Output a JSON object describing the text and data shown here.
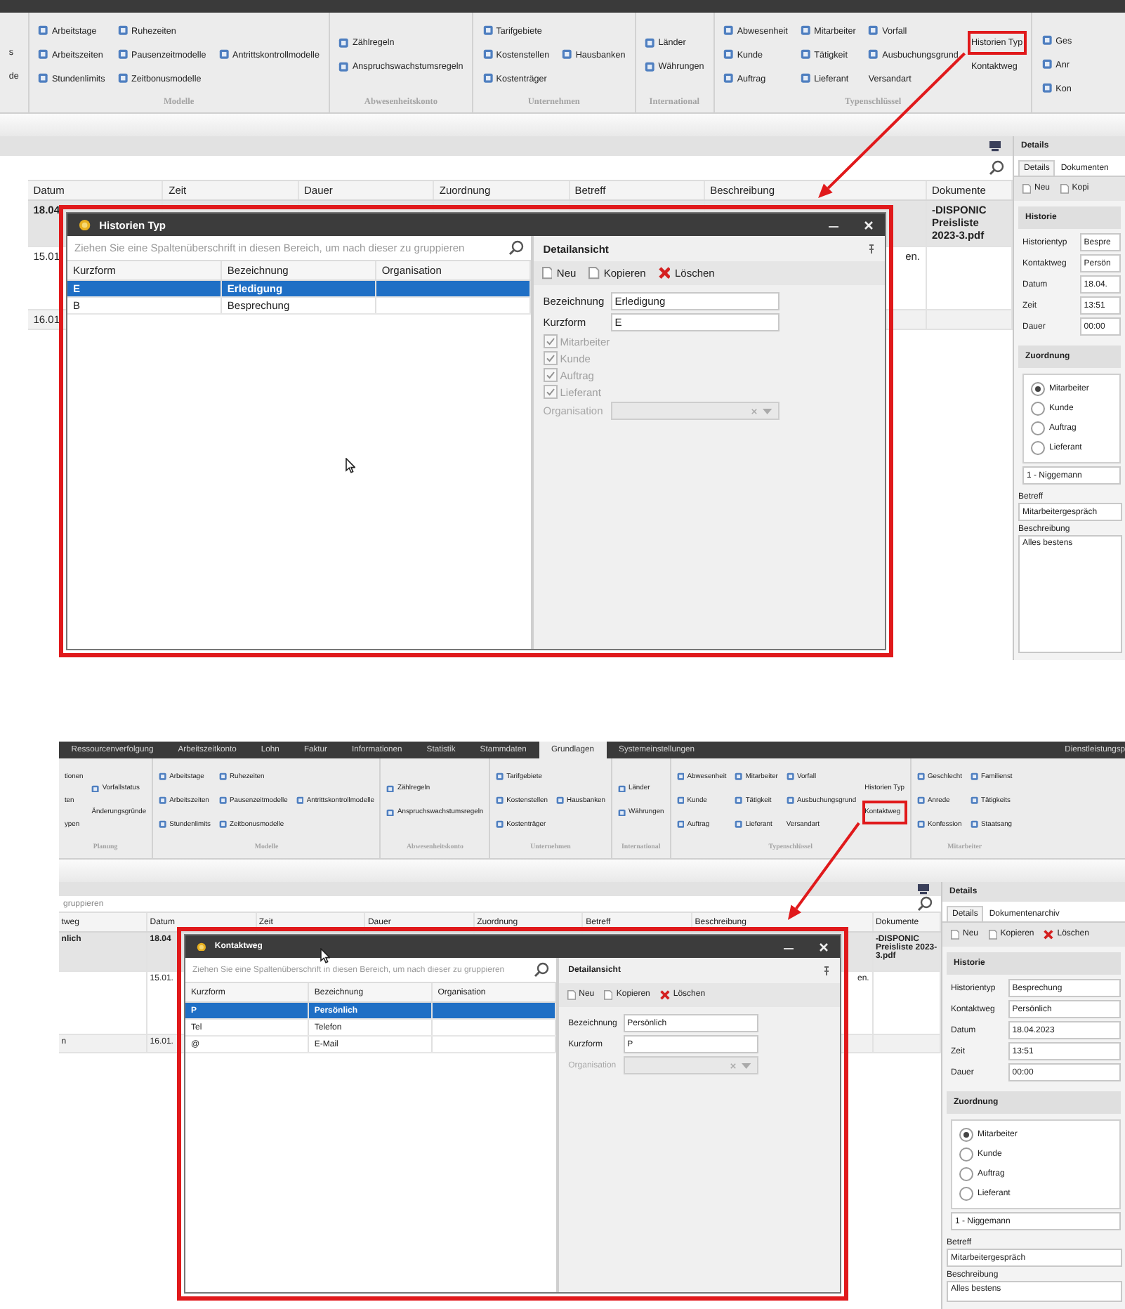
{
  "screenshots": [
    {
      "ribbon": [
        {
          "columns": [
            [
              {
                "label": "s",
                "icon": false,
                "marked": false
              },
              {
                "label": "de",
                "icon": false,
                "marked": false
              }
            ]
          ]
        },
        {
          "label": "Modelle",
          "columns": [
            [
              {
                "label": "Arbeitstage",
                "icon": true,
                "marked": false
              },
              {
                "label": "Arbeitszeiten",
                "icon": true,
                "marked": false
              },
              {
                "label": "Stundenlimits",
                "icon": true,
                "marked": false
              }
            ],
            [
              {
                "label": "Ruhezeiten",
                "icon": true,
                "marked": false
              },
              {
                "label": "Pausenzeitmodelle",
                "icon": true,
                "marked": false
              },
              {
                "label": "Zeitbonusmodelle",
                "icon": true,
                "marked": false
              }
            ],
            [
              {
                "label": "Antrittskontrollmodelle",
                "icon": true,
                "marked": false
              }
            ]
          ]
        },
        {
          "label": "Abwesenheitskonto",
          "columns": [
            [
              {
                "label": "Zählregeln",
                "icon": true,
                "marked": false
              },
              {
                "label": "Anspruchswachstumsregeln",
                "icon": true,
                "marked": false
              }
            ]
          ]
        },
        {
          "label": "Unternehmen",
          "columns": [
            [
              {
                "label": "Tarifgebiete",
                "icon": true,
                "marked": false
              },
              {
                "label": "Kostenstellen",
                "icon": true,
                "marked": false
              },
              {
                "label": "Kostenträger",
                "icon": true,
                "marked": false
              }
            ],
            [
              {
                "label": "Hausbanken",
                "icon": true,
                "marked": false
              }
            ]
          ]
        },
        {
          "label": "International",
          "columns": [
            [
              {
                "label": "Länder",
                "icon": true,
                "marked": false
              },
              {
                "label": "Währungen",
                "icon": true,
                "marked": false
              }
            ]
          ]
        },
        {
          "label": "Typenschlüssel",
          "columns": [
            [
              {
                "label": "Abwesenheit",
                "icon": true,
                "marked": false
              },
              {
                "label": "Kunde",
                "icon": true,
                "marked": false
              },
              {
                "label": "Auftrag",
                "icon": true,
                "marked": false
              }
            ],
            [
              {
                "label": "Mitarbeiter",
                "icon": true,
                "marked": false
              },
              {
                "label": "Tätigkeit",
                "icon": true,
                "marked": false
              },
              {
                "label": "Lieferant",
                "icon": true,
                "marked": false
              }
            ],
            [
              {
                "label": "Vorfall",
                "icon": true,
                "marked": false
              },
              {
                "label": "Ausbuchungsgrund",
                "icon": true,
                "marked": false
              },
              {
                "label": "Versandart",
                "icon": false,
                "marked": false
              }
            ],
            [
              {
                "label": "Historien Typ",
                "icon": false,
                "marked": true
              },
              {
                "label": "Kontaktweg",
                "icon": false,
                "marked": false
              }
            ]
          ]
        },
        {
          "columns": [
            [
              {
                "label": "Ges",
                "icon": true,
                "marked": false
              },
              {
                "label": "Anr",
                "icon": true,
                "marked": false
              },
              {
                "label": "Kon",
                "icon": true,
                "marked": false
              }
            ]
          ]
        }
      ],
      "grid": {
        "columns": [
          "Datum",
          "Zeit",
          "Dauer",
          "Zuordnung",
          "Betreff",
          "Beschreibung",
          "Dokumente"
        ],
        "rows": [
          {
            "selected": true,
            "cells": [
              "18.04",
              null,
              null,
              null,
              null,
              null,
              "-DISPONIC Preisliste 2023-3.pdf"
            ]
          },
          {
            "selected": false,
            "cells": [
              "15.01",
              null,
              null,
              null,
              null,
              "en.",
              null
            ]
          },
          {
            "selected": false,
            "cells": [
              "16.01",
              null,
              null,
              null,
              null,
              null,
              null
            ]
          }
        ]
      },
      "details": {
        "title": "Details",
        "tabs": [
          {
            "label": "Details",
            "selected": true
          },
          {
            "label": "Dokumenten",
            "selected": false
          }
        ],
        "actions": [
          {
            "label": "Neu",
            "kind": "new"
          },
          {
            "label": "Kopi",
            "kind": "copy"
          }
        ],
        "history": {
          "title": "Historie",
          "fields": [
            {
              "label": "Historientyp",
              "value": "Bespre"
            },
            {
              "label": "Kontaktweg",
              "value": "Persön"
            },
            {
              "label": "Datum",
              "value": "18.04."
            },
            {
              "label": "Zeit",
              "value": "13:51"
            },
            {
              "label": "Dauer",
              "value": "00:00"
            }
          ]
        },
        "assignment": {
          "title": "Zuordnung",
          "options": [
            {
              "label": "Mitarbeiter",
              "selected": true
            },
            {
              "label": "Kunde",
              "selected": false
            },
            {
              "label": "Auftrag",
              "selected": false
            },
            {
              "label": "Lieferant",
              "selected": false
            }
          ],
          "dropdown": "1 - Niggemann"
        },
        "subject": {
          "label": "Betreff",
          "value": "Mitarbeitergespräch"
        },
        "description": {
          "label": "Beschreibung",
          "value": "Alles bestens"
        }
      },
      "dialog": {
        "title": "Historien Typ",
        "marked": true,
        "search_placeholder": "Ziehen Sie eine Spaltenüberschrift in diesen Bereich, um nach dieser zu gruppieren",
        "columns": [
          "Kurzform",
          "Bezeichnung",
          "Organisation"
        ],
        "rows": [
          {
            "selected": true,
            "cells": [
              "E",
              "Erledigung",
              null
            ]
          },
          {
            "selected": false,
            "cells": [
              "B",
              "Besprechung",
              null
            ]
          }
        ],
        "detail": {
          "title": "Detailansicht",
          "actions": [
            {
              "label": "Neu",
              "kind": "new"
            },
            {
              "label": "Kopieren",
              "kind": "copy"
            },
            {
              "label": "Löschen",
              "kind": "delete"
            }
          ],
          "fields": [
            {
              "label": "Bezeichnung",
              "value": "Erledigung"
            },
            {
              "label": "Kurzform",
              "value": "E"
            }
          ],
          "checkboxes": [
            {
              "label": "Mitarbeiter",
              "checked": true,
              "disabled": true
            },
            {
              "label": "Kunde",
              "checked": true,
              "disabled": true
            },
            {
              "label": "Auftrag",
              "checked": true,
              "disabled": true
            },
            {
              "label": "Lieferant",
              "checked": true,
              "disabled": true
            }
          ],
          "dropdown": {
            "label": "Organisation",
            "disabled": true
          }
        }
      }
    },
    {
      "tabs": [
        {
          "label": "Ressourcenverfolgung",
          "selected": false
        },
        {
          "label": "Arbeitszeitkonto",
          "selected": false
        },
        {
          "label": "Lohn",
          "selected": false
        },
        {
          "label": "Faktur",
          "selected": false
        },
        {
          "label": "Informationen",
          "selected": false
        },
        {
          "label": "Statistik",
          "selected": false
        },
        {
          "label": "Stammdaten",
          "selected": false
        },
        {
          "label": "Grundlagen",
          "selected": true
        },
        {
          "label": "Systemeinstellungen",
          "selected": false
        }
      ],
      "side_tab": "Dienstleistungsp",
      "ribbon": [
        {
          "label": "Planung",
          "columns": [
            [
              {
                "label": "tionen",
                "icon": false,
                "marked": false
              },
              {
                "label": "ten",
                "icon": false,
                "marked": false
              },
              {
                "label": "ypen",
                "icon": false,
                "marked": false
              }
            ],
            [
              {
                "label": "Vorfallstatus",
                "icon": true,
                "marked": false
              },
              {
                "label": "Änderungsgründe",
                "icon": false,
                "marked": false
              }
            ]
          ]
        },
        {
          "label": "Modelle",
          "columns": [
            [
              {
                "label": "Arbeitstage",
                "icon": true,
                "marked": false
              },
              {
                "label": "Arbeitszeiten",
                "icon": true,
                "marked": false
              },
              {
                "label": "Stundenlimits",
                "icon": true,
                "marked": false
              }
            ],
            [
              {
                "label": "Ruhezeiten",
                "icon": true,
                "marked": false
              },
              {
                "label": "Pausenzeitmodelle",
                "icon": true,
                "marked": false
              },
              {
                "label": "Zeitbonusmodelle",
                "icon": true,
                "marked": false
              }
            ],
            [
              {
                "label": "Antrittskontrollmodelle",
                "icon": true,
                "marked": false
              }
            ]
          ]
        },
        {
          "label": "Abwesenheitskonto",
          "columns": [
            [
              {
                "label": "Zählregeln",
                "icon": true,
                "marked": false
              },
              {
                "label": "Anspruchswachstumsregeln",
                "icon": true,
                "marked": false
              }
            ]
          ]
        },
        {
          "label": "Unternehmen",
          "columns": [
            [
              {
                "label": "Tarifgebiete",
                "icon": true,
                "marked": false
              },
              {
                "label": "Kostenstellen",
                "icon": true,
                "marked": false
              },
              {
                "label": "Kostenträger",
                "icon": true,
                "marked": false
              }
            ],
            [
              {
                "label": "Hausbanken",
                "icon": true,
                "marked": false
              }
            ]
          ]
        },
        {
          "label": "International",
          "columns": [
            [
              {
                "label": "Länder",
                "icon": true,
                "marked": false
              },
              {
                "label": "Währungen",
                "icon": true,
                "marked": false
              }
            ]
          ]
        },
        {
          "label": "Typenschlüssel",
          "columns": [
            [
              {
                "label": "Abwesenheit",
                "icon": true,
                "marked": false
              },
              {
                "label": "Kunde",
                "icon": true,
                "marked": false
              },
              {
                "label": "Auftrag",
                "icon": true,
                "marked": false
              }
            ],
            [
              {
                "label": "Mitarbeiter",
                "icon": true,
                "marked": false
              },
              {
                "label": "Tätigkeit",
                "icon": true,
                "marked": false
              },
              {
                "label": "Lieferant",
                "icon": true,
                "marked": false
              }
            ],
            [
              {
                "label": "Vorfall",
                "icon": true,
                "marked": false
              },
              {
                "label": "Ausbuchungsgrund",
                "icon": true,
                "marked": false
              },
              {
                "label": "Versandart",
                "icon": false,
                "marked": false
              }
            ],
            [
              {
                "label": "Historien Typ",
                "icon": false,
                "marked": false
              },
              {
                "label": "Kontaktweg",
                "icon": false,
                "marked": true
              }
            ]
          ]
        },
        {
          "label": "Mitarbeiter",
          "columns": [
            [
              {
                "label": "Geschlecht",
                "icon": true,
                "marked": false
              },
              {
                "label": "Anrede",
                "icon": true,
                "marked": false
              },
              {
                "label": "Konfession",
                "icon": true,
                "marked": false
              }
            ],
            [
              {
                "label": "Familienst",
                "icon": true,
                "marked": false
              },
              {
                "label": "Tätigkeits",
                "icon": true,
                "marked": false
              },
              {
                "label": "Staatsang",
                "icon": true,
                "marked": false
              }
            ]
          ]
        }
      ],
      "grid": {
        "search_placeholder": "gruppieren",
        "columns": [
          "tweg",
          "Datum",
          "Zeit",
          "Dauer",
          "Zuordnung",
          "Betreff",
          "Beschreibung",
          "Dokumente"
        ],
        "rows": [
          {
            "selected": true,
            "cells": [
              "nlich",
              "18.04",
              null,
              null,
              null,
              null,
              null,
              "-DISPONIC Preisliste 2023-3.pdf"
            ]
          },
          {
            "selected": false,
            "cells": [
              null,
              "15.01.",
              null,
              null,
              null,
              null,
              "en.",
              null
            ]
          },
          {
            "selected": false,
            "cells": [
              "n",
              "16.01.",
              null,
              null,
              null,
              null,
              null,
              null
            ]
          }
        ]
      },
      "details": {
        "title": "Details",
        "tabs": [
          {
            "label": "Details",
            "selected": true
          },
          {
            "label": "Dokumentenarchiv",
            "selected": false
          }
        ],
        "actions": [
          {
            "label": "Neu",
            "kind": "new"
          },
          {
            "label": "Kopieren",
            "kind": "copy"
          },
          {
            "label": "Löschen",
            "kind": "delete"
          }
        ],
        "history": {
          "title": "Historie",
          "fields": [
            {
              "label": "Historientyp",
              "value": "Besprechung"
            },
            {
              "label": "Kontaktweg",
              "value": "Persönlich"
            },
            {
              "label": "Datum",
              "value": "18.04.2023"
            },
            {
              "label": "Zeit",
              "value": "13:51"
            },
            {
              "label": "Dauer",
              "value": "00:00"
            }
          ]
        },
        "assignment": {
          "title": "Zuordnung",
          "options": [
            {
              "label": "Mitarbeiter",
              "selected": true
            },
            {
              "label": "Kunde",
              "selected": false
            },
            {
              "label": "Auftrag",
              "selected": false
            },
            {
              "label": "Lieferant",
              "selected": false
            }
          ],
          "dropdown": "1 - Niggemann"
        },
        "subject": {
          "label": "Betreff",
          "value": "Mitarbeitergespräch"
        },
        "description": {
          "label": "Beschreibung",
          "value": "Alles bestens"
        }
      },
      "dialog": {
        "title": "Kontaktweg",
        "marked": true,
        "search_placeholder": "Ziehen Sie eine Spaltenüberschrift in diesen Bereich, um nach dieser zu gruppieren",
        "columns": [
          "Kurzform",
          "Bezeichnung",
          "Organisation"
        ],
        "rows": [
          {
            "selected": true,
            "cells": [
              "P",
              "Persönlich",
              null
            ]
          },
          {
            "selected": false,
            "cells": [
              "Tel",
              "Telefon",
              null
            ]
          },
          {
            "selected": false,
            "cells": [
              "@",
              "E-Mail",
              null
            ]
          }
        ],
        "detail": {
          "title": "Detailansicht",
          "actions": [
            {
              "label": "Neu",
              "kind": "new"
            },
            {
              "label": "Kopieren",
              "kind": "copy"
            },
            {
              "label": "Löschen",
              "kind": "delete"
            }
          ],
          "fields": [
            {
              "label": "Bezeichnung",
              "value": "Persönlich"
            },
            {
              "label": "Kurzform",
              "value": "P"
            }
          ],
          "dropdown": {
            "label": "Organisation",
            "disabled": true
          }
        }
      }
    }
  ]
}
